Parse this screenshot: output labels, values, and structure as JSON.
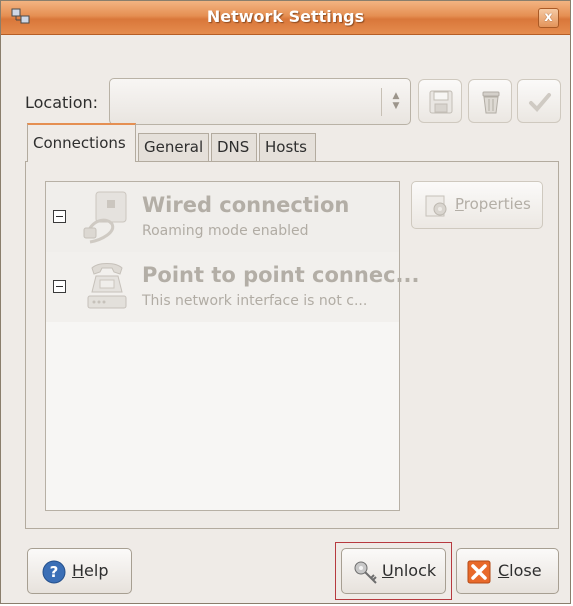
{
  "window": {
    "title": "Network Settings",
    "close_glyph": "x"
  },
  "location": {
    "label": "Location:",
    "value": "",
    "buttons": [
      {
        "name": "save-location-button",
        "icon": "floppy-disk-icon"
      },
      {
        "name": "delete-location-button",
        "icon": "trash-can-icon"
      },
      {
        "name": "apply-location-button",
        "icon": "check-mark-icon"
      }
    ]
  },
  "tabs": [
    {
      "label": "Connections",
      "active": true
    },
    {
      "label": "General",
      "active": false
    },
    {
      "label": "DNS",
      "active": false
    },
    {
      "label": "Hosts",
      "active": false
    }
  ],
  "connections": [
    {
      "title": "Wired connection",
      "subtitle": "Roaming mode enabled",
      "icon": "wired-connection-icon",
      "enabled": false
    },
    {
      "title": "Point to point connec...",
      "subtitle": "This network interface is not c...",
      "icon": "telephone-modem-icon",
      "enabled": false
    }
  ],
  "properties_button": {
    "label_prefix": "",
    "mnemonic": "P",
    "label_rest": "roperties",
    "enabled": false
  },
  "footer": {
    "help": {
      "mnemonic": "H",
      "rest": "elp",
      "icon": "help-icon"
    },
    "unlock": {
      "mnemonic": "U",
      "rest": "nlock",
      "icon": "keys-icon",
      "highlight_color": "#b73a3f"
    },
    "close": {
      "mnemonic": "C",
      "rest": "lose",
      "icon": "close-icon"
    }
  },
  "colors": {
    "titlebar_accent": "#e58f52",
    "disabled_text": "#b3aea6",
    "window_bg": "#efebe7"
  }
}
